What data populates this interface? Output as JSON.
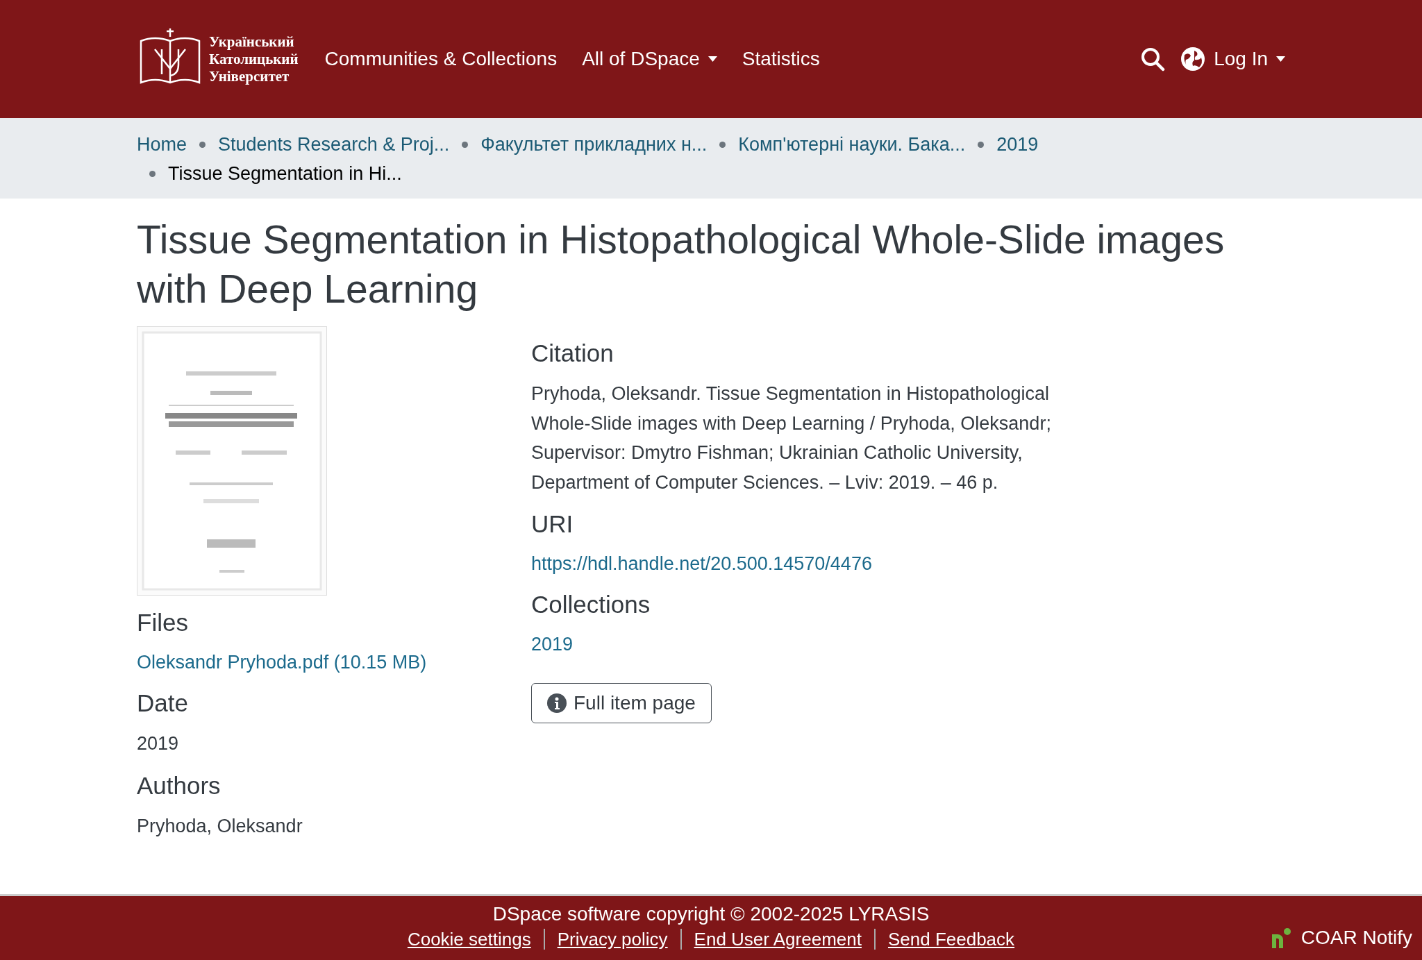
{
  "header": {
    "logo_lines": [
      "Український",
      "Католицький",
      "Університет"
    ],
    "nav": [
      {
        "label": "Communities & Collections",
        "has_menu": false
      },
      {
        "label": "All of DSpace",
        "has_menu": true
      },
      {
        "label": "Statistics",
        "has_menu": false
      }
    ],
    "login": "Log In"
  },
  "breadcrumb": [
    {
      "label": "Home",
      "current": false
    },
    {
      "label": "Students Research & Proj...",
      "current": false
    },
    {
      "label": "Факультет прикладних н...",
      "current": false
    },
    {
      "label": "Комп'ютерні науки. Бака...",
      "current": false
    },
    {
      "label": "2019",
      "current": false
    },
    {
      "label": "Tissue Segmentation in Hi...",
      "current": true
    }
  ],
  "title": "Tissue Segmentation in Histopathological Whole-Slide images with Deep Learning",
  "left_sections": [
    {
      "heading": "Files",
      "kind": "link",
      "value": "Oleksandr Pryhoda.pdf (10.15 MB)"
    },
    {
      "heading": "Date",
      "kind": "text",
      "value": "2019"
    },
    {
      "heading": "Authors",
      "kind": "text",
      "value": "Pryhoda, Oleksandr"
    }
  ],
  "right_sections": [
    {
      "heading": "Citation",
      "kind": "text",
      "value": "Pryhoda, Oleksandr. Tissue Segmentation in Histopathological Whole-Slide images with Deep Learning / Pryhoda, Oleksandr; Supervisor: Dmytro Fishman; Ukrainian Catholic University, Department of Computer Sciences. – Lviv: 2019. – 46 p."
    },
    {
      "heading": "URI",
      "kind": "link",
      "value": "https://hdl.handle.net/20.500.14570/4476"
    },
    {
      "heading": "Collections",
      "kind": "link",
      "value": "2019"
    }
  ],
  "full_item_button": "Full item page",
  "footer": {
    "copyright": "DSpace software copyright © 2002-2025 LYRASIS",
    "links": [
      "Cookie settings",
      "Privacy policy",
      "End User Agreement",
      "Send Feedback"
    ],
    "badge": "COAR Notify"
  }
}
